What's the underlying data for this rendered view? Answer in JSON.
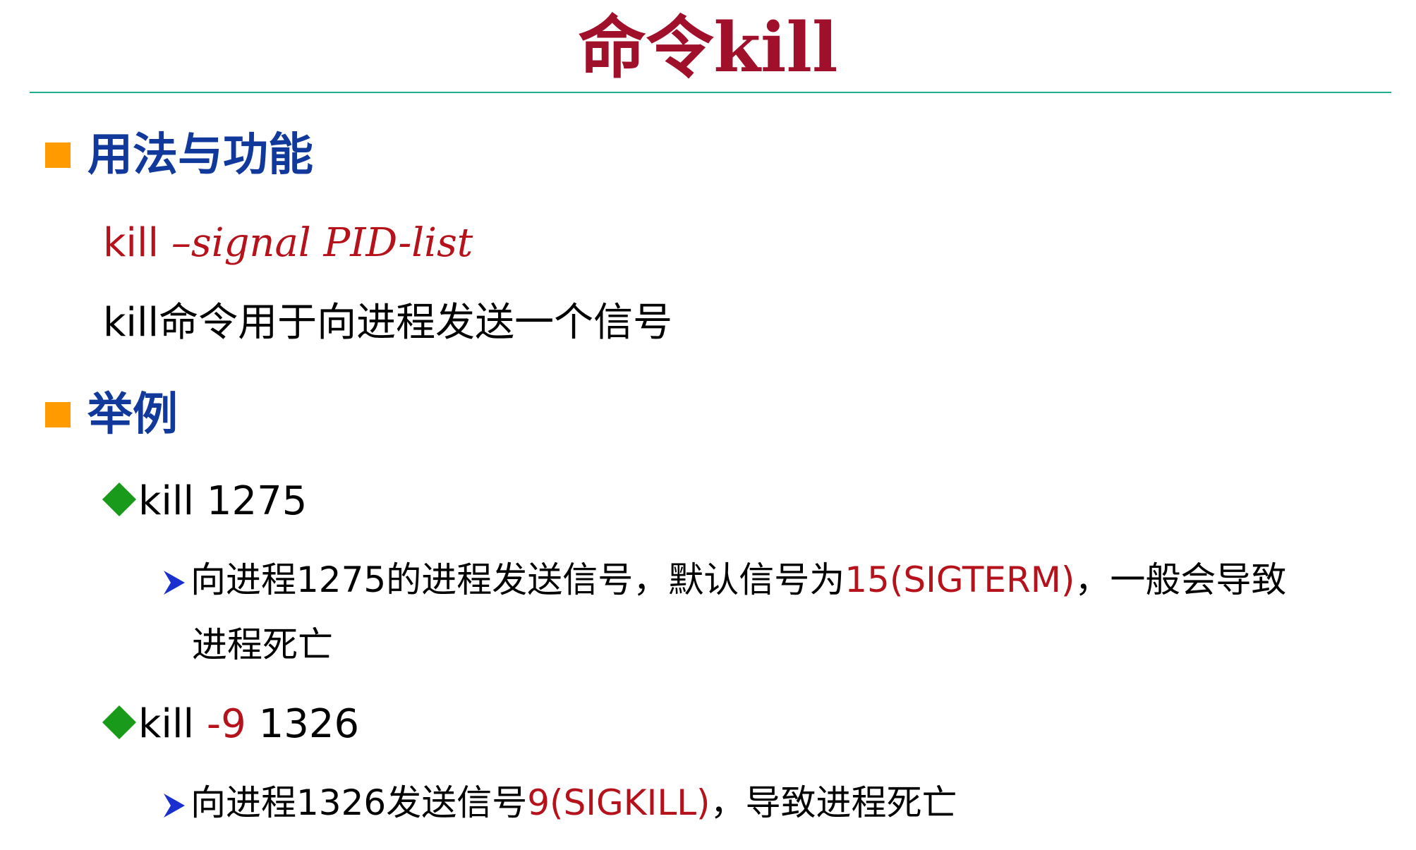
{
  "title": "命令kill",
  "sections": [
    {
      "heading": "用法与功能",
      "syntax": {
        "cmd": "kill",
        "opt": "–signal PID-list"
      },
      "description": "kill命令用于向进程发送一个信号"
    },
    {
      "heading": "举例",
      "examples": [
        {
          "cmd": "kill",
          "args": "1275",
          "detail": {
            "before": "向进程1275的进程发送信号，默认信号为",
            "highlight": "15(SIGTERM)",
            "after": "，一般会导致",
            "continuation": "进程死亡"
          }
        },
        {
          "cmd": "kill",
          "flag": "-9",
          "args": "1326",
          "detail": {
            "before": "向进程1326发送信号",
            "highlight": "9(SIGKILL)",
            "after": "，导致进程死亡"
          }
        }
      ]
    }
  ],
  "colors": {
    "title": "#a0102a",
    "heading": "#10399b",
    "highlight": "#b5121b",
    "bullet_square": "#ff9a00",
    "bullet_diamond": "#1a9a1a",
    "bullet_arrow": "#1a2fd0",
    "rule": "#1fae8f"
  },
  "icons": [
    "orange-square-bullet-icon",
    "green-diamond-bullet-icon",
    "blue-arrow-bullet-icon"
  ]
}
